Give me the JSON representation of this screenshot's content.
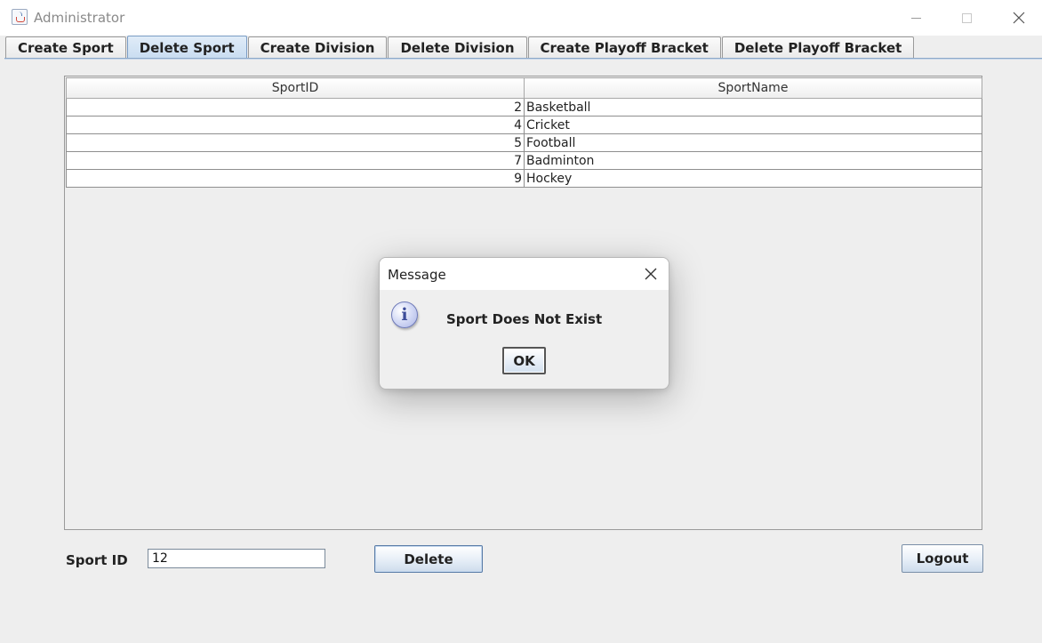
{
  "window": {
    "title": "Administrator",
    "minimize_icon": "minimize-icon",
    "maximize_icon": "maximize-icon",
    "close_icon": "close-icon"
  },
  "tabs": [
    {
      "label": "Create Sport",
      "active": false
    },
    {
      "label": "Delete Sport",
      "active": true
    },
    {
      "label": "Create Division",
      "active": false
    },
    {
      "label": "Delete Division",
      "active": false
    },
    {
      "label": "Create Playoff Bracket",
      "active": false
    },
    {
      "label": "Delete Playoff Bracket",
      "active": false
    }
  ],
  "table": {
    "columns": [
      "SportID",
      "SportName"
    ],
    "rows": [
      {
        "id": "2",
        "name": "Basketball"
      },
      {
        "id": "4",
        "name": "Cricket"
      },
      {
        "id": "5",
        "name": "Football"
      },
      {
        "id": "7",
        "name": "Badminton"
      },
      {
        "id": "9",
        "name": "Hockey"
      }
    ]
  },
  "form": {
    "sport_id_label": "Sport ID",
    "sport_id_value": "12",
    "delete_label": "Delete",
    "logout_label": "Logout"
  },
  "dialog": {
    "title": "Message",
    "message": "Sport Does Not Exist",
    "ok_label": "OK",
    "icon": "info-icon",
    "icon_glyph": "i"
  },
  "colors": {
    "active_tab": "#c8dcf0",
    "background": "#eeeeee"
  }
}
